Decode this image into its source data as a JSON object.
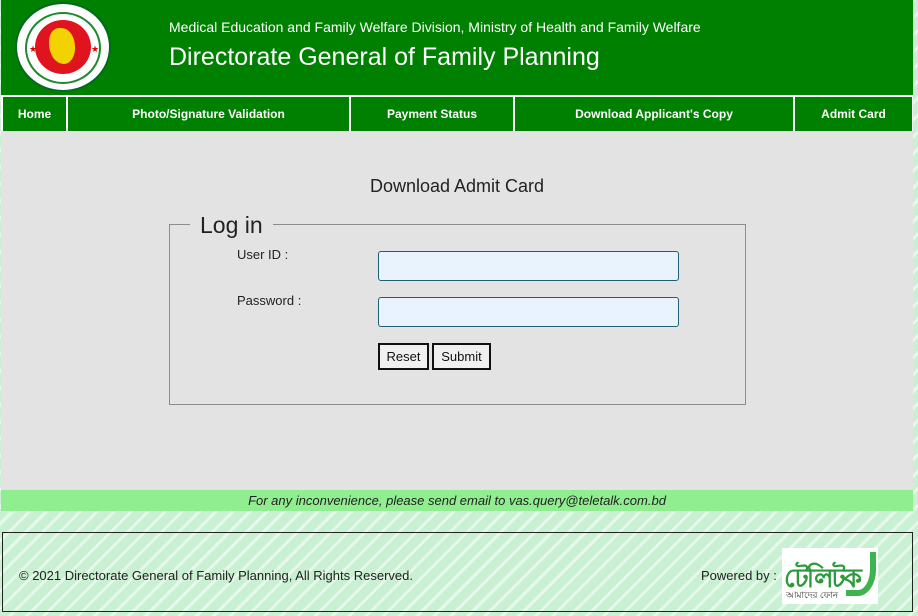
{
  "header": {
    "subtitle": "Medical Education and Family Welfare Division, Ministry of Health and Family Welfare",
    "title": "Directorate General of Family Planning"
  },
  "nav": {
    "items": [
      {
        "label": "Home"
      },
      {
        "label": "Photo/Signature Validation"
      },
      {
        "label": "Payment Status"
      },
      {
        "label": "Download Applicant's Copy"
      },
      {
        "label": "Admit Card"
      }
    ]
  },
  "main": {
    "page_title": "Download Admit Card",
    "form": {
      "legend": "Log in",
      "user_id_label": "User ID :",
      "user_id_value": "",
      "password_label": "Password :",
      "password_value": "",
      "reset_label": "Reset",
      "submit_label": "Submit"
    }
  },
  "notice": {
    "text": "For any inconvenience, please send email to vas.query@teletalk.com.bd"
  },
  "footer": {
    "copyright": "© 2021 Directorate General of Family Planning, All Rights Reserved.",
    "powered_by": "Powered by :",
    "logo_icon": "teletalk-logo"
  },
  "colors": {
    "brand_green": "#008000",
    "content_bg": "#e3e3e3",
    "notice_bg": "#90ee90",
    "input_bg": "#e8f3fd"
  }
}
